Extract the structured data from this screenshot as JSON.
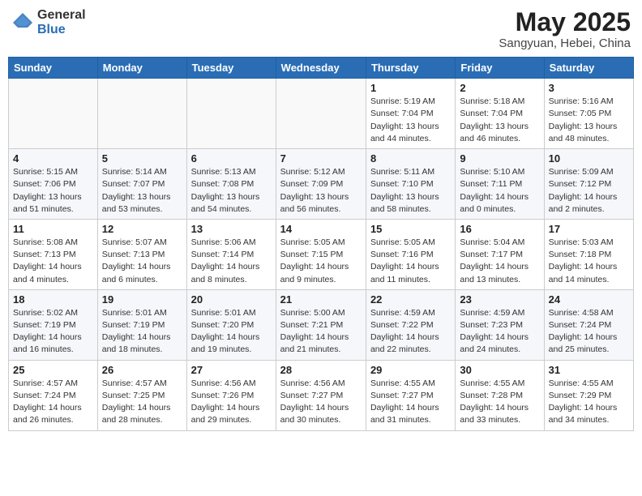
{
  "header": {
    "logo_general": "General",
    "logo_blue": "Blue",
    "month": "May 2025",
    "location": "Sangyuan, Hebei, China"
  },
  "weekdays": [
    "Sunday",
    "Monday",
    "Tuesday",
    "Wednesday",
    "Thursday",
    "Friday",
    "Saturday"
  ],
  "weeks": [
    [
      {
        "day": "",
        "info": ""
      },
      {
        "day": "",
        "info": ""
      },
      {
        "day": "",
        "info": ""
      },
      {
        "day": "",
        "info": ""
      },
      {
        "day": "1",
        "info": "Sunrise: 5:19 AM\nSunset: 7:04 PM\nDaylight: 13 hours\nand 44 minutes."
      },
      {
        "day": "2",
        "info": "Sunrise: 5:18 AM\nSunset: 7:04 PM\nDaylight: 13 hours\nand 46 minutes."
      },
      {
        "day": "3",
        "info": "Sunrise: 5:16 AM\nSunset: 7:05 PM\nDaylight: 13 hours\nand 48 minutes."
      }
    ],
    [
      {
        "day": "4",
        "info": "Sunrise: 5:15 AM\nSunset: 7:06 PM\nDaylight: 13 hours\nand 51 minutes."
      },
      {
        "day": "5",
        "info": "Sunrise: 5:14 AM\nSunset: 7:07 PM\nDaylight: 13 hours\nand 53 minutes."
      },
      {
        "day": "6",
        "info": "Sunrise: 5:13 AM\nSunset: 7:08 PM\nDaylight: 13 hours\nand 54 minutes."
      },
      {
        "day": "7",
        "info": "Sunrise: 5:12 AM\nSunset: 7:09 PM\nDaylight: 13 hours\nand 56 minutes."
      },
      {
        "day": "8",
        "info": "Sunrise: 5:11 AM\nSunset: 7:10 PM\nDaylight: 13 hours\nand 58 minutes."
      },
      {
        "day": "9",
        "info": "Sunrise: 5:10 AM\nSunset: 7:11 PM\nDaylight: 14 hours\nand 0 minutes."
      },
      {
        "day": "10",
        "info": "Sunrise: 5:09 AM\nSunset: 7:12 PM\nDaylight: 14 hours\nand 2 minutes."
      }
    ],
    [
      {
        "day": "11",
        "info": "Sunrise: 5:08 AM\nSunset: 7:13 PM\nDaylight: 14 hours\nand 4 minutes."
      },
      {
        "day": "12",
        "info": "Sunrise: 5:07 AM\nSunset: 7:13 PM\nDaylight: 14 hours\nand 6 minutes."
      },
      {
        "day": "13",
        "info": "Sunrise: 5:06 AM\nSunset: 7:14 PM\nDaylight: 14 hours\nand 8 minutes."
      },
      {
        "day": "14",
        "info": "Sunrise: 5:05 AM\nSunset: 7:15 PM\nDaylight: 14 hours\nand 9 minutes."
      },
      {
        "day": "15",
        "info": "Sunrise: 5:05 AM\nSunset: 7:16 PM\nDaylight: 14 hours\nand 11 minutes."
      },
      {
        "day": "16",
        "info": "Sunrise: 5:04 AM\nSunset: 7:17 PM\nDaylight: 14 hours\nand 13 minutes."
      },
      {
        "day": "17",
        "info": "Sunrise: 5:03 AM\nSunset: 7:18 PM\nDaylight: 14 hours\nand 14 minutes."
      }
    ],
    [
      {
        "day": "18",
        "info": "Sunrise: 5:02 AM\nSunset: 7:19 PM\nDaylight: 14 hours\nand 16 minutes."
      },
      {
        "day": "19",
        "info": "Sunrise: 5:01 AM\nSunset: 7:19 PM\nDaylight: 14 hours\nand 18 minutes."
      },
      {
        "day": "20",
        "info": "Sunrise: 5:01 AM\nSunset: 7:20 PM\nDaylight: 14 hours\nand 19 minutes."
      },
      {
        "day": "21",
        "info": "Sunrise: 5:00 AM\nSunset: 7:21 PM\nDaylight: 14 hours\nand 21 minutes."
      },
      {
        "day": "22",
        "info": "Sunrise: 4:59 AM\nSunset: 7:22 PM\nDaylight: 14 hours\nand 22 minutes."
      },
      {
        "day": "23",
        "info": "Sunrise: 4:59 AM\nSunset: 7:23 PM\nDaylight: 14 hours\nand 24 minutes."
      },
      {
        "day": "24",
        "info": "Sunrise: 4:58 AM\nSunset: 7:24 PM\nDaylight: 14 hours\nand 25 minutes."
      }
    ],
    [
      {
        "day": "25",
        "info": "Sunrise: 4:57 AM\nSunset: 7:24 PM\nDaylight: 14 hours\nand 26 minutes."
      },
      {
        "day": "26",
        "info": "Sunrise: 4:57 AM\nSunset: 7:25 PM\nDaylight: 14 hours\nand 28 minutes."
      },
      {
        "day": "27",
        "info": "Sunrise: 4:56 AM\nSunset: 7:26 PM\nDaylight: 14 hours\nand 29 minutes."
      },
      {
        "day": "28",
        "info": "Sunrise: 4:56 AM\nSunset: 7:27 PM\nDaylight: 14 hours\nand 30 minutes."
      },
      {
        "day": "29",
        "info": "Sunrise: 4:55 AM\nSunset: 7:27 PM\nDaylight: 14 hours\nand 31 minutes."
      },
      {
        "day": "30",
        "info": "Sunrise: 4:55 AM\nSunset: 7:28 PM\nDaylight: 14 hours\nand 33 minutes."
      },
      {
        "day": "31",
        "info": "Sunrise: 4:55 AM\nSunset: 7:29 PM\nDaylight: 14 hours\nand 34 minutes."
      }
    ]
  ]
}
